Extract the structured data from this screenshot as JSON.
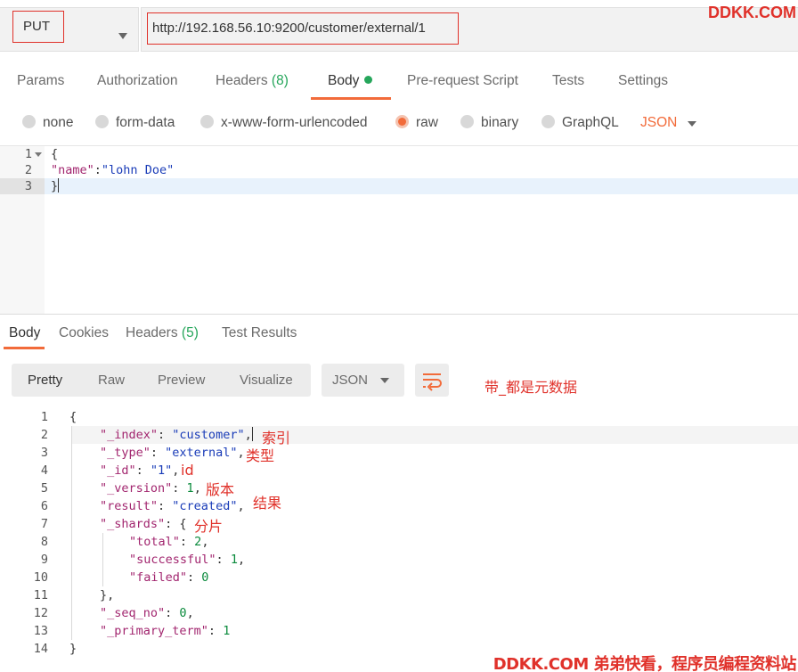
{
  "request": {
    "method": "PUT",
    "url": "http://192.168.56.10:9200/customer/external/1"
  },
  "watermark": {
    "top": "DDKK.COM",
    "bottom": "DDKK.COM 弟弟快看，程序员编程资料站"
  },
  "request_tabs": {
    "params": "Params",
    "authorization": "Authorization",
    "headers": "Headers",
    "headers_count": "(8)",
    "body": "Body",
    "prerequest": "Pre-request Script",
    "tests": "Tests",
    "settings": "Settings"
  },
  "body_types": {
    "none": "none",
    "form_data": "form-data",
    "urlencoded": "x-www-form-urlencoded",
    "raw": "raw",
    "binary": "binary",
    "graphql": "GraphQL",
    "language": "JSON",
    "selected": "raw"
  },
  "request_body": {
    "line_numbers": [
      "1",
      "2",
      "3"
    ],
    "line1": "{",
    "line2_key": "\"name\"",
    "line2_colon": ":",
    "line2_value": "\"lohn Doe\"",
    "line3": "}"
  },
  "response_tabs": {
    "body": "Body",
    "cookies": "Cookies",
    "headers": "Headers",
    "headers_count": "(5)",
    "test_results": "Test Results"
  },
  "response_view": {
    "pretty": "Pretty",
    "raw": "Raw",
    "preview": "Preview",
    "visualize": "Visualize",
    "format": "JSON"
  },
  "annotations": {
    "meta_note": "带_都是元数据",
    "index": "索引",
    "type": "类型",
    "id": "id",
    "version": "版本",
    "result": "结果",
    "shards": "分片"
  },
  "response_body": {
    "line_numbers": [
      "1",
      "2",
      "3",
      "4",
      "5",
      "6",
      "7",
      "8",
      "9",
      "10",
      "11",
      "12",
      "13",
      "14"
    ],
    "open": "{",
    "index_key": "\"_index\"",
    "index_value": "\"customer\"",
    "type_key": "\"_type\"",
    "type_value": "\"external\"",
    "id_key": "\"_id\"",
    "id_value": "\"1\"",
    "version_key": "\"_version\"",
    "version_value": "1",
    "result_key": "\"result\"",
    "result_value": "\"created\"",
    "shards_key": "\"_shards\"",
    "shards_open": "{",
    "total_key": "\"total\"",
    "total_value": "2",
    "successful_key": "\"successful\"",
    "successful_value": "1",
    "failed_key": "\"failed\"",
    "failed_value": "0",
    "shards_close": "},",
    "seq_no_key": "\"_seq_no\"",
    "seq_no_value": "0",
    "primary_term_key": "\"_primary_term\"",
    "primary_term_value": "1",
    "close": "}"
  },
  "colors": {
    "accent": "#f26b3a",
    "annotation_red": "#e0312a",
    "count_green": "#26a65b",
    "json_key": "#a2266f",
    "json_string": "#1a3cb8",
    "json_number": "#0a8a3c"
  },
  "icons": {
    "method_dropdown": "chevron-down-icon",
    "language_dropdown": "chevron-down-icon",
    "format_dropdown": "chevron-down-icon",
    "wrap": "wrap-lines-icon",
    "fold": "fold-arrow-icon"
  }
}
